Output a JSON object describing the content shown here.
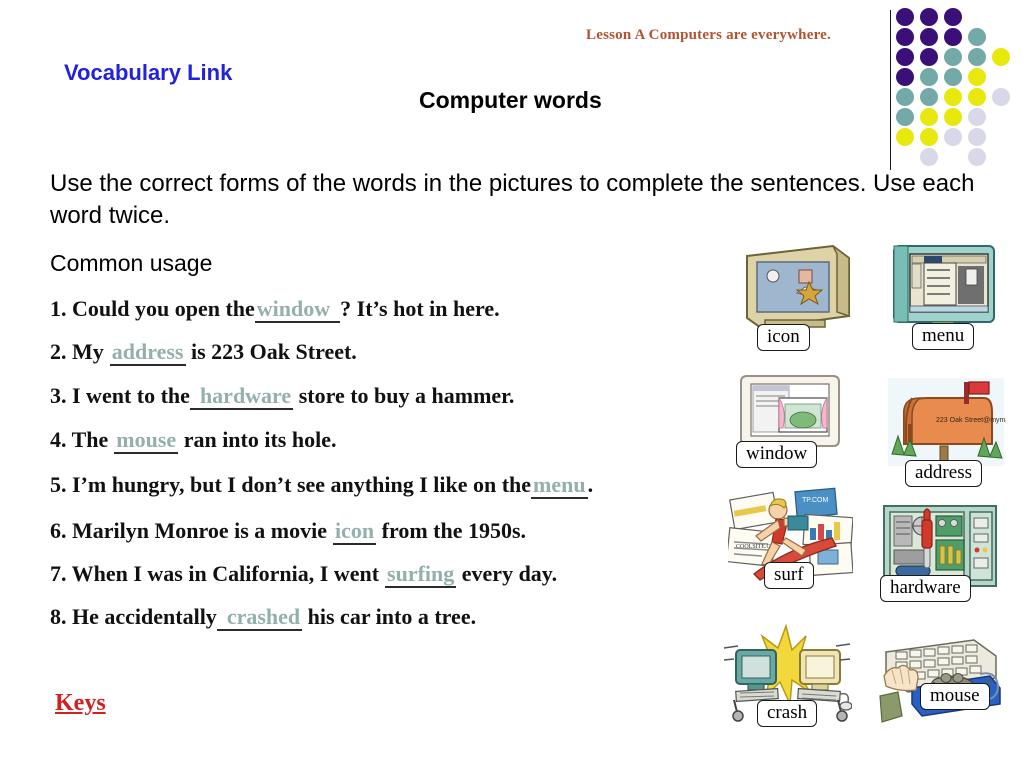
{
  "header": {
    "lesson": "Lesson A  Computers are everywhere.",
    "vocabulary_link": "Vocabulary Link",
    "section_title": "Computer words"
  },
  "instructions": "Use the correct forms of the words in the pictures to complete the sentences. Use each word twice.",
  "common_usage_label": "Common usage",
  "keys_label": "Keys",
  "sentences": [
    {
      "number": "1.",
      "before": "Could you open the",
      "answer": "window",
      "after": "? It’s hot in here."
    },
    {
      "number": "2.",
      "before": "My",
      "answer": "address",
      "after": "is 223 Oak Street."
    },
    {
      "number": "3.",
      "before": "I went to the",
      "answer": "hardware",
      "after": "store to buy a hammer."
    },
    {
      "number": "4.",
      "before": "The",
      "answer": "mouse",
      "after": "ran into its hole."
    },
    {
      "number": "5.",
      "before": "I’m hungry, but I don’t see anything I like on the",
      "answer": "menu",
      "after": "."
    },
    {
      "number": "6.",
      "before": "Marilyn Monroe is a movie",
      "answer": "icon",
      "after": "from the 1950s."
    },
    {
      "number": "7.",
      "before": "When I was in California, I went",
      "answer": "surfing",
      "after": "every day."
    },
    {
      "number": "8.",
      "before": "He accidentally",
      "answer": "crashed",
      "after": "his car into a tree."
    }
  ],
  "pictures": [
    {
      "label": "icon",
      "art": "monitor-icons"
    },
    {
      "label": "menu",
      "art": "monitor-menu"
    },
    {
      "label": "window",
      "art": "monitor-window"
    },
    {
      "label": "address",
      "art": "mailbox"
    },
    {
      "label": "surf",
      "art": "surfer"
    },
    {
      "label": "hardware",
      "art": "open-computer-case"
    },
    {
      "label": "crash",
      "art": "colliding-computers"
    },
    {
      "label": "mouse",
      "art": "mouse-on-mousepad"
    }
  ],
  "decoration": {
    "dot_colors": {
      "purple": "#3a1078",
      "teal": "#73aaa8",
      "yellow": "#e8e80f",
      "lavender": "#d8d8e8"
    },
    "dot_grid": [
      [
        "purple",
        "purple",
        "purple",
        "",
        ""
      ],
      [
        "purple",
        "purple",
        "purple",
        "teal",
        ""
      ],
      [
        "purple",
        "purple",
        "teal",
        "teal",
        "yellow"
      ],
      [
        "purple",
        "teal",
        "teal",
        "yellow",
        ""
      ],
      [
        "teal",
        "teal",
        "yellow",
        "yellow",
        "lavender"
      ],
      [
        "teal",
        "yellow",
        "yellow",
        "lavender",
        ""
      ],
      [
        "yellow",
        "yellow",
        "lavender",
        "lavender",
        ""
      ],
      [
        "",
        "lavender",
        "",
        "lavender",
        ""
      ]
    ]
  },
  "colors": {
    "lesson_red": "#b4522f",
    "vocab_blue": "#2222dd",
    "answer_teal": "#93b0ac",
    "keys_red": "#d31f1f"
  }
}
